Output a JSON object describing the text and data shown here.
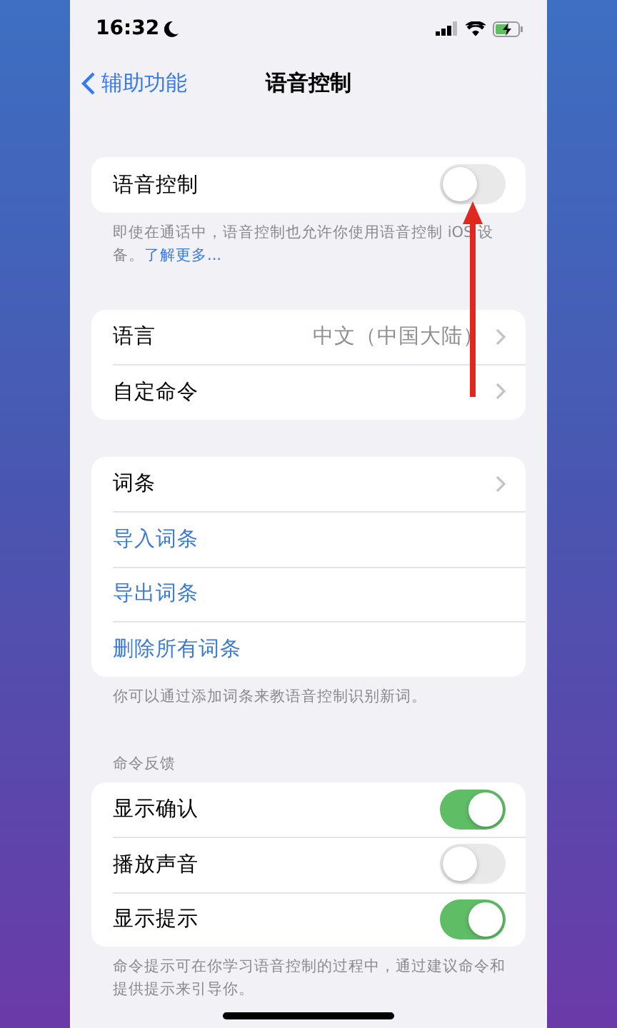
{
  "status_bar": {
    "time": "16:32"
  },
  "nav": {
    "back": "辅助功能",
    "title": "语音控制"
  },
  "sections": [
    {
      "rows": [
        {
          "kind": "toggle",
          "label": "语音控制",
          "on": false
        }
      ],
      "footer": "即使在通话中，语音控制也允许你使用语音控制 iOS 设备。",
      "footer_link": "了解更多..."
    },
    {
      "rows": [
        {
          "kind": "nav",
          "label": "语言",
          "value": "中文（中国大陆）"
        },
        {
          "kind": "nav",
          "label": "自定命令"
        }
      ]
    },
    {
      "rows": [
        {
          "kind": "nav",
          "label": "词条"
        },
        {
          "kind": "action",
          "label": "导入词条"
        },
        {
          "kind": "action",
          "label": "导出词条"
        },
        {
          "kind": "action",
          "label": "删除所有词条"
        }
      ],
      "footer": "你可以通过添加词条来教语音控制识别新词。"
    },
    {
      "header": "命令反馈",
      "rows": [
        {
          "kind": "toggle",
          "label": "显示确认",
          "on": true
        },
        {
          "kind": "toggle",
          "label": "播放声音",
          "on": false
        },
        {
          "kind": "toggle",
          "label": "显示提示",
          "on": true
        }
      ],
      "footer": "命令提示可在你学习语音控制的过程中，通过建议命令和提供提示来引导你。"
    }
  ]
}
